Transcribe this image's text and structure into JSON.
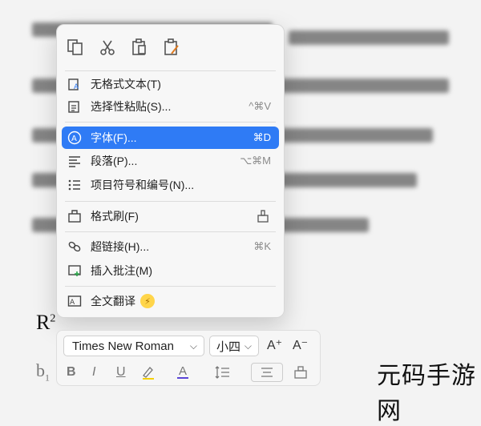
{
  "menu": {
    "toolbar": [
      "copy-icon",
      "cut-icon",
      "paste-icon",
      "paste-format-icon"
    ],
    "items": [
      {
        "label": "无格式文本(T)",
        "shortcut": ""
      },
      {
        "label": "选择性粘贴(S)...",
        "shortcut": "^⌘V"
      },
      {
        "label": "字体(F)...",
        "shortcut": "⌘D"
      },
      {
        "label": "段落(P)...",
        "shortcut": "⌥⌘M"
      },
      {
        "label": "项目符号和编号(N)...",
        "shortcut": ""
      },
      {
        "label": "格式刷(F)",
        "shortcut": ""
      },
      {
        "label": "超链接(H)...",
        "shortcut": "⌘K"
      },
      {
        "label": "插入批注(M)",
        "shortcut": ""
      },
      {
        "label": "全文翻译",
        "shortcut": ""
      }
    ]
  },
  "format_bar": {
    "font": "Times New Roman",
    "size": "小四",
    "buttons": {
      "bold": "B",
      "italic": "I",
      "underline": "U",
      "font_color": "A"
    }
  },
  "doc": {
    "r_sup_base": "R",
    "r_sup": "2",
    "b_sub": "b",
    "b_sub_idx": "1"
  },
  "watermark": "元码手游网",
  "colors": {
    "highlight": "#2f7bf5",
    "badge": "#ffd54a"
  }
}
